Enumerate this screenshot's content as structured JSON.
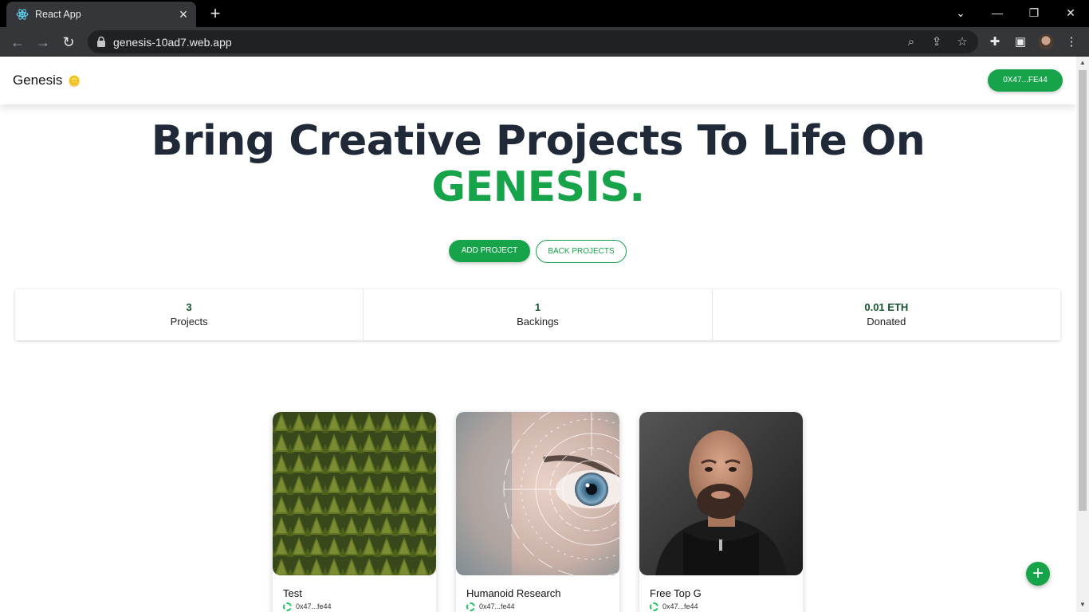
{
  "browser": {
    "tab_title": "React App",
    "url": "genesis-10ad7.web.app"
  },
  "header": {
    "brand": "Genesis",
    "brand_icon": "coin-stack-icon",
    "wallet_label": "0X47...FE44"
  },
  "hero": {
    "line1": "Bring Creative Projects To Life On",
    "line2": "GENESIS."
  },
  "actions": {
    "add_project": "ADD PROJECT",
    "back_projects": "BACK PROJECTS"
  },
  "stats": [
    {
      "value": "3",
      "label": "Projects"
    },
    {
      "value": "1",
      "label": "Backings"
    },
    {
      "value": "0.01 ETH",
      "label": "Donated"
    }
  ],
  "projects": [
    {
      "title": "Test",
      "owner": "0x47...fe44",
      "image": "pine-forest-aerial"
    },
    {
      "title": "Humanoid Research",
      "owner": "0x47...fe44",
      "image": "digital-eye-closeup"
    },
    {
      "title": "Free Top G",
      "owner": "0x47...fe44",
      "image": "portrait-man-black-hoodie"
    }
  ],
  "colors": {
    "accent": "#16a34a",
    "heading": "#1f2937"
  }
}
